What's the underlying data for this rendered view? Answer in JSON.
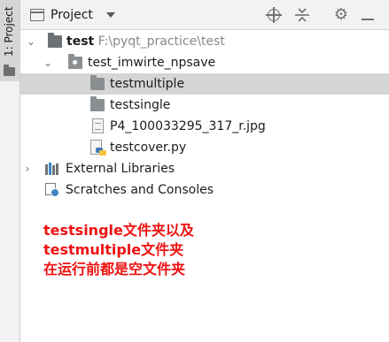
{
  "sidebar": {
    "tab_label": "1: Project"
  },
  "header": {
    "title": "Project"
  },
  "tree": {
    "root_name": "test",
    "root_path": "F:\\pyqt_practice\\test",
    "folder_name": "test_imwirte_npsave",
    "items": [
      {
        "label": "testmultiple"
      },
      {
        "label": "testsingle"
      },
      {
        "label": "P4_100033295_317_r.jpg"
      },
      {
        "label": "testcover.py"
      }
    ],
    "external_libraries": "External Libraries",
    "scratches": "Scratches and Consoles"
  },
  "annotation": {
    "line1": "testsingle文件夹以及",
    "line2": "testmultiple文件夹",
    "line3": "在运行前都是空文件夹"
  },
  "colors": {
    "selection": "#d5d5d5",
    "annotation": "#ee1111",
    "python_blue": "#3c79b6",
    "python_yellow": "#f2c338"
  }
}
